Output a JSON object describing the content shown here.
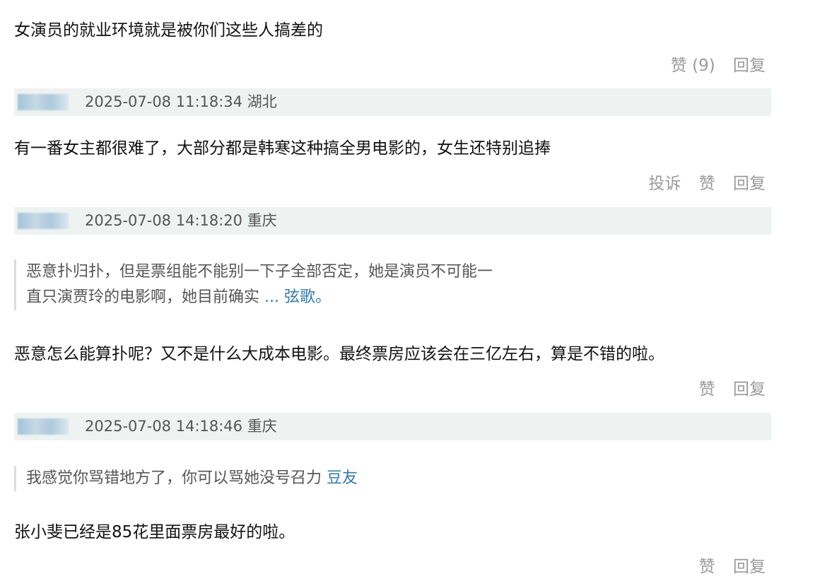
{
  "comments": [
    {
      "text": "女演员的就业环境就是被你们这些人搞差的",
      "actions": {
        "like": "赞 (9)",
        "reply": "回复"
      }
    },
    {
      "meta": "2025-07-08 11:18:34 湖北",
      "text": "有一番女主都很难了，大部分都是韩寒这种搞全男电影的，女生还特别追捧",
      "actions": {
        "report": "投诉",
        "like": "赞",
        "reply": "回复"
      }
    },
    {
      "meta": "2025-07-08 14:18:20 重庆",
      "quote": {
        "line1": "恶意扑归扑，但是票组能不能别一下子全部否定，她是演员不可能一",
        "line2": "直只演贾玲的电影啊，她目前确实",
        "more": "...",
        "author": "弦歌",
        "tail": "。"
      },
      "text": "恶意怎么能算扑呢？又不是什么大成本电影。最终票房应该会在三亿左右，算是不错的啦。",
      "actions": {
        "like": "赞",
        "reply": "回复"
      }
    },
    {
      "meta": "2025-07-08 14:18:46 重庆",
      "quote": {
        "line1": "我感觉你骂错地方了，你可以骂她没号召力",
        "author": "豆友"
      },
      "text": "张小斐已经是85花里面票房最好的啦。",
      "actions": {
        "like": "赞",
        "reply": "回复"
      }
    }
  ]
}
